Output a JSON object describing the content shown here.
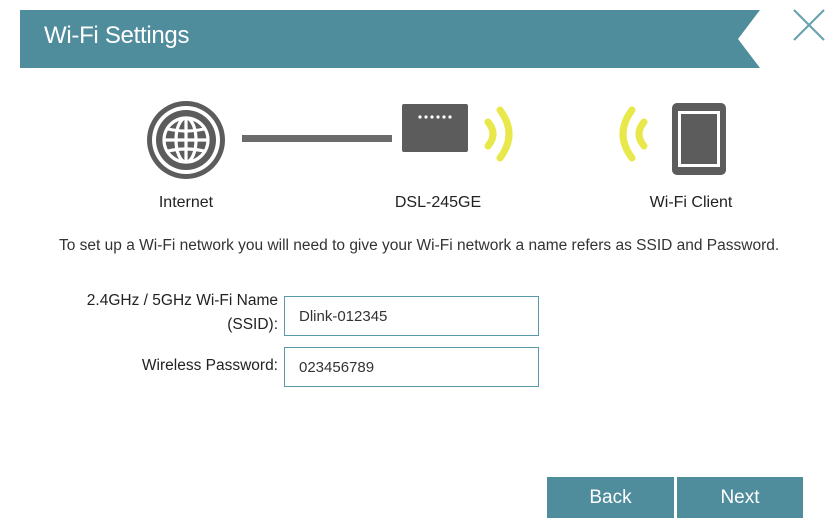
{
  "header": {
    "title": "Wi-Fi Settings",
    "banner_color": "#4f8d9d",
    "close_icon": "close-icon"
  },
  "diagram": {
    "internet": {
      "label": "Internet",
      "icon": "globe-icon"
    },
    "router": {
      "label": "DSL-245GE",
      "icon": "router-icon",
      "signal_color": "#e8e84a"
    },
    "client": {
      "label": "Wi-Fi Client",
      "icon": "tablet-icon"
    }
  },
  "intro": "To set up a Wi-Fi network you will need to give your Wi-Fi network a name refers as SSID and Password.",
  "form": {
    "ssid": {
      "label_line1": "2.4GHz / 5GHz Wi-Fi Name",
      "label_line2": "(SSID):",
      "value": "Dlink-012345"
    },
    "password": {
      "label": "Wireless Password:",
      "value": "023456789"
    }
  },
  "buttons": {
    "back": "Back",
    "next": "Next"
  }
}
